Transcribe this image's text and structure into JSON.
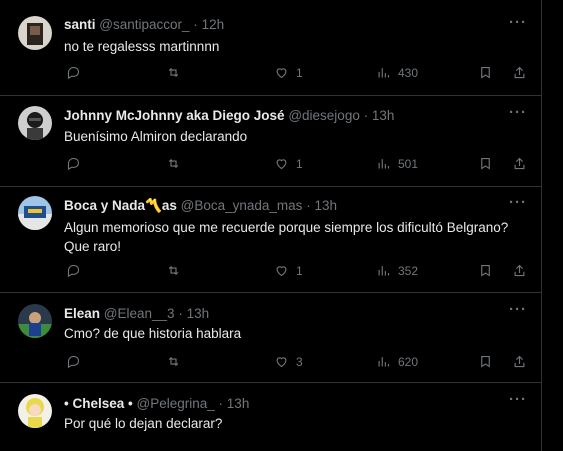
{
  "tweets": [
    {
      "name": "santi",
      "handle": "@santipaccor_",
      "time": "12h",
      "text": "no te regalesss martinnnn",
      "likes": "1",
      "views": "430",
      "avatar": {
        "bg": "#d9d4cc",
        "fg": "#2a2520"
      }
    },
    {
      "name": "Johnny McJohnny aka Diego José",
      "handle": "@diesejogo",
      "time": "13h",
      "text": "Buenísimo Almiron declarando",
      "likes": "1",
      "views": "501",
      "avatar": {
        "bg": "#cfcfcf",
        "fg": "#1b1b1b"
      }
    },
    {
      "name": "Boca y Nada",
      "name_emoji": "〽️",
      "name_suffix": "as",
      "handle": "@Boca_ynada_mas",
      "time": "13h",
      "text": "Algun memorioso que me recuerde porque siempre los dificultó Belgrano? Que raro!",
      "likes": "1",
      "views": "352",
      "avatar": {
        "bg": "#9fc6e6",
        "fg": "#1f4f8f"
      }
    },
    {
      "name": "Elean",
      "handle": "@Elean__3",
      "time": "13h",
      "text": "Cmo? de que historia hablara",
      "likes": "3",
      "views": "620",
      "avatar": {
        "bg": "#2b3a4a",
        "fg": "#3c8c3c"
      }
    },
    {
      "name": "• Chelsea •",
      "handle": "@Pelegrina_",
      "time": "13h",
      "text": "Por qué lo dejan declarar?",
      "avatar": {
        "bg": "#e8d84a",
        "fg": "#f3f0e8"
      }
    }
  ],
  "ui": {
    "more": "···",
    "separator": "·"
  },
  "colors": {
    "background": "#000000",
    "text": "#e7e9ea",
    "muted": "#71767b",
    "divider": "#2f3336"
  }
}
